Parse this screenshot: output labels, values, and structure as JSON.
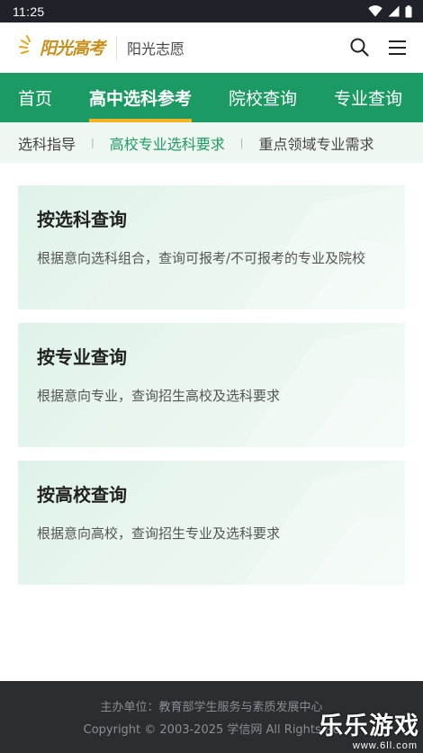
{
  "status_bar": {
    "time": "11:25"
  },
  "header": {
    "logo_text": "阳光高考",
    "site_name": "阳光志愿"
  },
  "main_nav": {
    "items": [
      {
        "label": "首页"
      },
      {
        "label": "高中选科参考"
      },
      {
        "label": "院校查询"
      },
      {
        "label": "专业查询"
      }
    ]
  },
  "sub_nav": {
    "items": [
      {
        "label": "选科指导"
      },
      {
        "label": "高校专业选科要求"
      },
      {
        "label": "重点领域专业需求"
      }
    ]
  },
  "cards": [
    {
      "title": "按选科查询",
      "desc": "根据意向选科组合，查询可报考/不可报考的专业及院校"
    },
    {
      "title": "按专业查询",
      "desc": "根据意向专业，查询招生高校及选科要求"
    },
    {
      "title": "按高校查询",
      "desc": "根据意向高校，查询招生专业及选科要求"
    }
  ],
  "footer": {
    "organizer": "主办单位：教育部学生服务与素质发展中心",
    "copyright": "Copyright © 2003-2025 学信网 All Rights Re"
  },
  "watermark": {
    "title": "乐乐游戏",
    "url": "www.6ll.com"
  },
  "colors": {
    "brand_green": "#1c9a63",
    "accent_orange": "#f5b324",
    "card_bg": "#e6f5ee"
  }
}
